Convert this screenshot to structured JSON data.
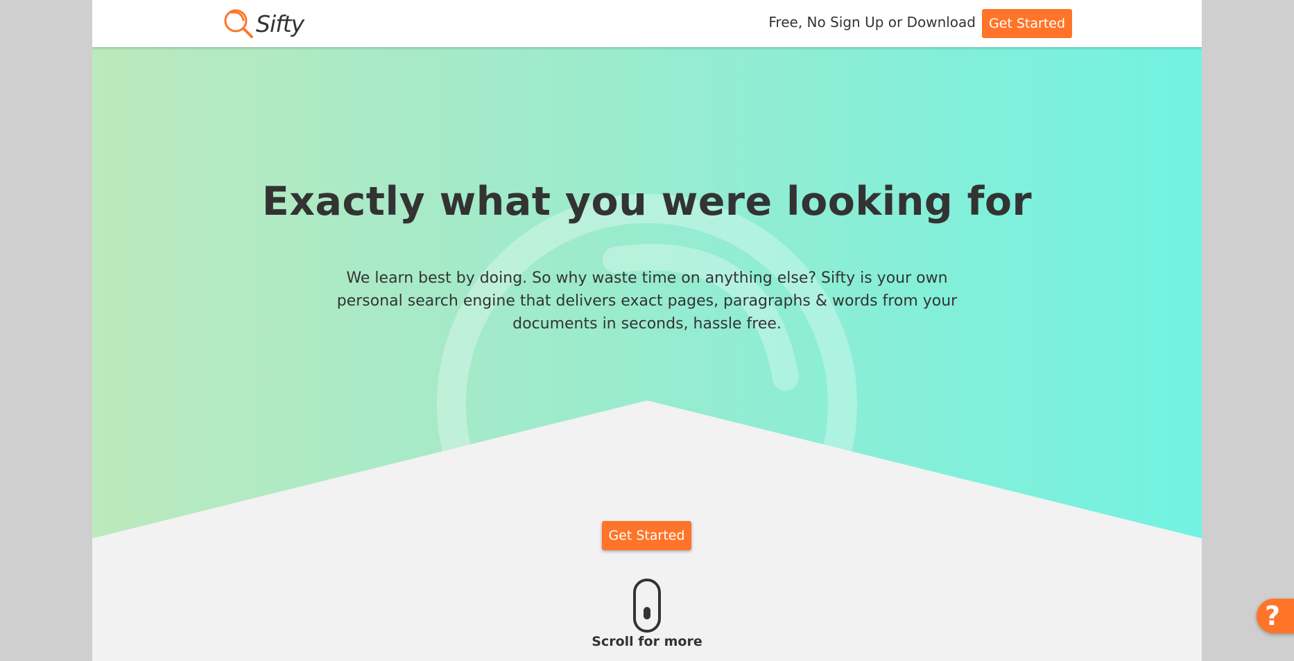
{
  "header": {
    "brand": "Sifty",
    "tagline": "Free, No Sign Up or Download",
    "cta_label": "Get Started"
  },
  "hero": {
    "title": "Exactly what you were looking for",
    "description": "We learn best by doing. So why waste time on anything else? Sifty is your own personal search engine that delivers exact pages, paragraphs & words from your documents in seconds, hassle free.",
    "cta_label": "Get Started",
    "scroll_hint": "Scroll for more"
  },
  "help": {
    "label": "?"
  },
  "colors": {
    "accent": "#ff7428",
    "text": "#333333",
    "gradient_start": "#bce9bd",
    "gradient_end": "#72f2e2",
    "floor": "#f2f2f2"
  },
  "icons": [
    "magnifier-logo-icon",
    "mouse-scroll-icon",
    "question-mark-icon"
  ]
}
